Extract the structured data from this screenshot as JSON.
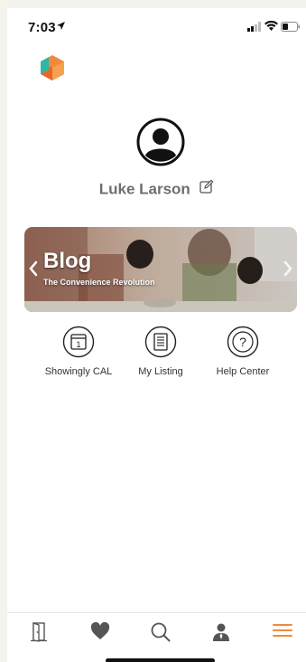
{
  "status": {
    "time": "7:03"
  },
  "profile": {
    "name": "Luke Larson"
  },
  "banner": {
    "title": "Blog",
    "subtitle": "The Convenience Revolution"
  },
  "quick_links": [
    {
      "label": "Showingly CAL",
      "icon": "calendar-icon"
    },
    {
      "label": "My Listing",
      "icon": "listing-icon"
    },
    {
      "label": "Help Center",
      "icon": "help-icon"
    }
  ],
  "tabs": [
    {
      "name": "exit",
      "icon": "door-icon"
    },
    {
      "name": "favorites",
      "icon": "heart-icon"
    },
    {
      "name": "search",
      "icon": "search-icon"
    },
    {
      "name": "agent",
      "icon": "agent-icon"
    },
    {
      "name": "menu",
      "icon": "hamburger-icon",
      "active": true
    }
  ],
  "colors": {
    "accent": "#f08a3c",
    "icon_gray": "#555555",
    "banner_tint": "#a06a52"
  }
}
